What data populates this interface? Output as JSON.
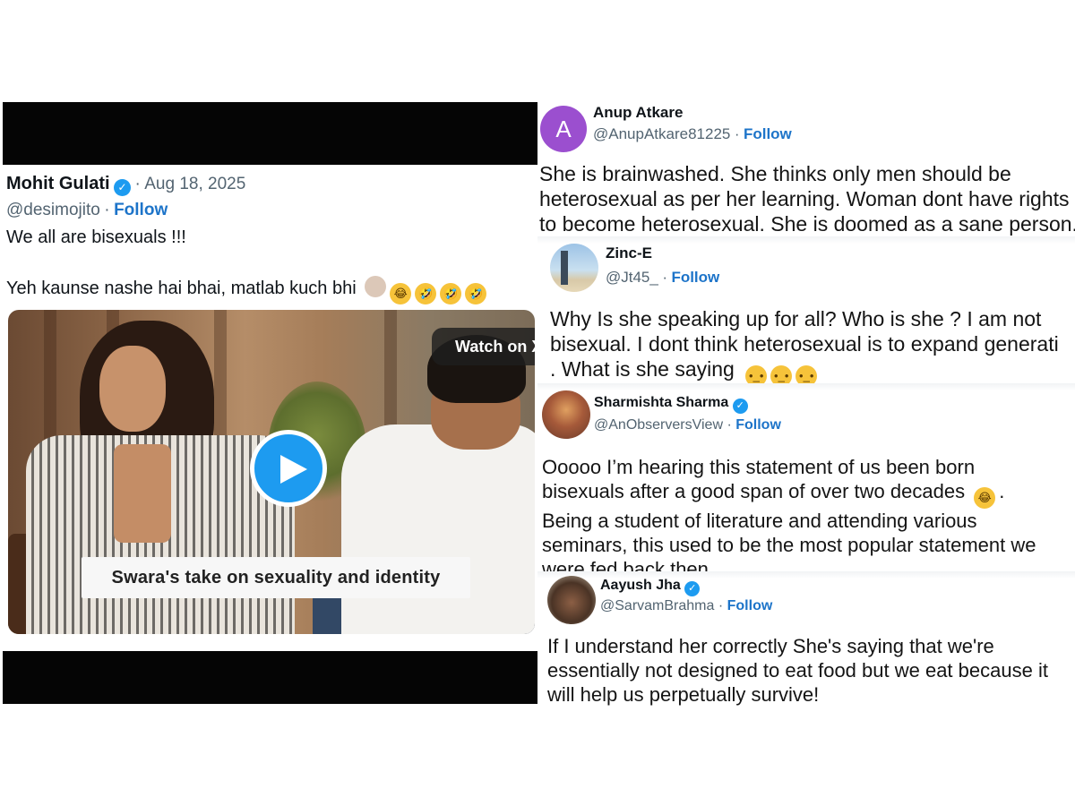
{
  "left_tweet": {
    "author_name": "Mohit Gulati",
    "date": "Aug 18, 2025",
    "handle": "@desimojito",
    "follow_label": "Follow",
    "line1": "We all are bisexuals !!!",
    "line2": "Yeh kaunse nashe hai bhai, matlab kuch bhi",
    "video": {
      "watch_label": "Watch on X",
      "caption": "Swara's take on sexuality and identity"
    }
  },
  "replies": [
    {
      "name": "Anup Atkare",
      "avatar_letter": "A",
      "handle": "@AnupAtkare81225",
      "follow_label": "Follow",
      "lines": [
        "She is brainwashed. She thinks only men should be",
        "heterosexual as per her learning. Woman dont have rights",
        "to become heterosexual.  She is doomed as a sane person."
      ]
    },
    {
      "name": "Zinc-E",
      "handle": "@Jt45_",
      "follow_label": "Follow",
      "lines": [
        "Why Is she speaking up for all? Who is she ? I am not",
        "bisexual. I dont think heterosexual is to expand generati",
        ". What is she saying"
      ]
    },
    {
      "name": "Sharmishta Sharma",
      "handle": "@AnObserversView",
      "follow_label": "Follow",
      "lines": [
        "Ooooo I’m hearing this statement of us been born",
        "bisexuals after a good span of over two decades",
        "Being a student of literature and attending various",
        "seminars, this used to be the most popular statement we",
        "were fed back then."
      ]
    },
    {
      "name": "Aayush Jha",
      "handle": "@SarvamBrahma",
      "follow_label": "Follow",
      "lines": [
        "If I understand her correctly She's saying that we're",
        "essentially not designed to eat food but we eat because it",
        "will help us perpetually survive!"
      ]
    }
  ],
  "colors": {
    "follow": "#1d74c9",
    "verified": "#1d9bf0",
    "avatar_purple": "#9b4fcf"
  }
}
